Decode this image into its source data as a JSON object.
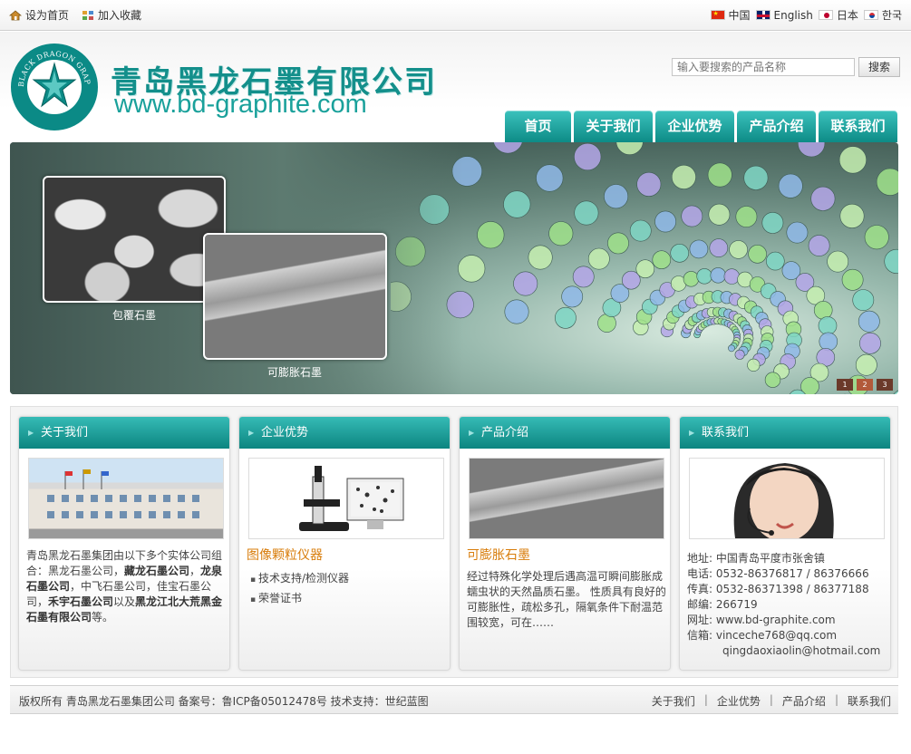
{
  "topbar": {
    "left_links": [
      {
        "label": "设为首页",
        "icon": "home-icon"
      },
      {
        "label": "加入收藏",
        "icon": "bookmark-icon"
      }
    ],
    "languages": [
      {
        "label": "中国",
        "flag": "flag-cn"
      },
      {
        "label": "English",
        "flag": "flag-uk"
      },
      {
        "label": "日本",
        "flag": "flag-jp"
      },
      {
        "label": "한국",
        "flag": "flag-kr"
      }
    ]
  },
  "header": {
    "logo_text": "BLACK DRAGON GRAPHITE",
    "company_name": "青岛黑龙石墨有限公司",
    "company_url": "www.bd-graphite.com",
    "search_placeholder": "输入要搜索的产品名称",
    "search_button": "搜索",
    "nav": [
      "首页",
      "关于我们",
      "企业优势",
      "产品介绍",
      "联系我们"
    ]
  },
  "banner": {
    "captions": [
      "包覆石墨",
      "可膨胀石墨"
    ],
    "slides": [
      "1",
      "2",
      "3"
    ],
    "active_slide": 1
  },
  "boxes": {
    "about": {
      "title": "关于我们",
      "text_1": "青岛黑龙石墨集团由以下多个实体公司组合：黑龙石墨公司，",
      "bold_1": "藏龙石墨公司",
      "text_2": "，",
      "bold_2": "龙泉石墨公司",
      "text_3": "，中飞石墨公司，佳宝石墨公司，",
      "bold_3": "禾宇石墨公司",
      "text_4": "以及",
      "bold_4": "黑龙江北大荒黑金石墨有限公司",
      "text_5": "等。"
    },
    "advantage": {
      "title": "企业优势",
      "subtitle": "图像颗粒仪器",
      "items": [
        "技术支持/检测仪器",
        "荣誉证书"
      ]
    },
    "products": {
      "title": "产品介绍",
      "subtitle": "可膨胀石墨",
      "description": "经过特殊化学处理后遇高温可瞬间膨胀成蠕虫状的天然晶质石墨。 性质具有良好的可膨胀性，疏松多孔，隔氧条件下耐温范围较宽，可在……"
    },
    "contact": {
      "title": "联系我们",
      "lines": [
        {
          "label": "地址:",
          "value": "中国青岛平度市张舍镇"
        },
        {
          "label": "电话:",
          "value": "0532-86376817 / 86376666"
        },
        {
          "label": "传真:",
          "value": "0532-86371398 / 86377188"
        },
        {
          "label": "邮编:",
          "value": "266719"
        },
        {
          "label": "网址:",
          "value": "www.bd-graphite.com"
        },
        {
          "label": "信箱:",
          "value": "vinceche768@qq.com"
        },
        {
          "label": "",
          "value": "qingdaoxiaolin@hotmail.com"
        }
      ]
    }
  },
  "footer": {
    "copyright": "版权所有 青岛黑龙石墨集团公司 备案号：鲁ICP备05012478号 技术支持：世纪蓝图",
    "links": [
      "关于我们",
      "企业优势",
      "产品介绍",
      "联系我们"
    ],
    "separator": "|"
  },
  "colors": {
    "brand_teal": "#0d8b86",
    "accent_orange": "#d87c0a"
  }
}
